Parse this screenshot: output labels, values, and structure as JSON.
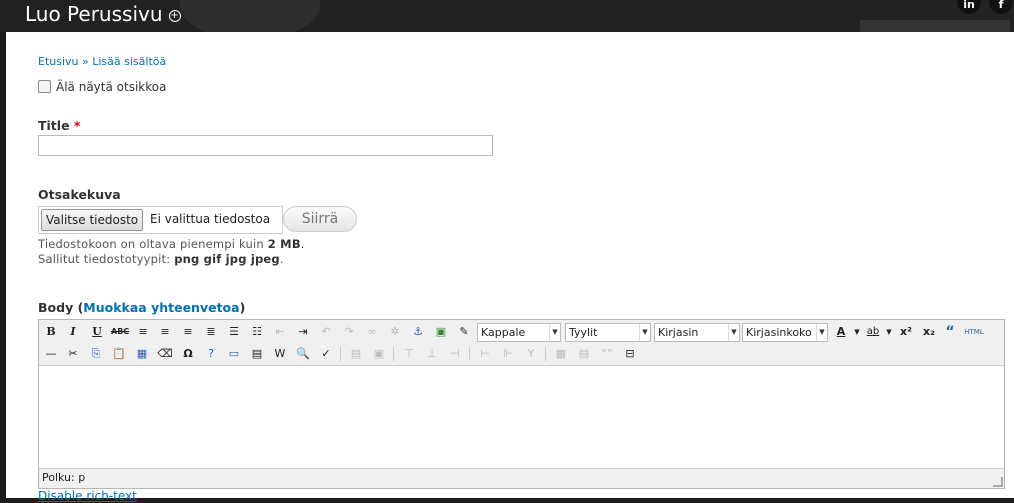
{
  "header": {
    "page_title": "Luo Perussivu"
  },
  "breadcrumb": {
    "home": "Etusivu",
    "separator": "»",
    "current": "Lisää sisältöä"
  },
  "hide_title_checkbox": {
    "label": "Älä näytä otsikkoa",
    "checked": false
  },
  "title_field": {
    "label": "Title",
    "required_marker": "*",
    "value": ""
  },
  "header_image": {
    "label": "Otsakekuva",
    "choose_button": "Valitse tiedosto",
    "no_file_text": "Ei valittua tiedostoa",
    "upload_button": "Siirrä",
    "help_size_prefix": "Tiedostokoon on oltava pienempi kuin",
    "help_size_value": "2 MB",
    "help_types_prefix": "Sallitut tiedostotyypit:",
    "help_types_value": "png gif jpg jpeg"
  },
  "body_field": {
    "label": "Body",
    "summary_link": "Muokkaa yhteenvetoa",
    "toolbar": {
      "format_combo": "Kappale",
      "styles_combo": "Tyylit",
      "font_combo": "Kirjasin",
      "size_combo": "Kirjasinkoko"
    },
    "path_prefix": "Polku:",
    "path_value": "p",
    "disable_rich_text": "Disable rich-text"
  },
  "colors": {
    "link": "#0071b3",
    "required": "#ee0000",
    "header_bg": "#222222"
  }
}
